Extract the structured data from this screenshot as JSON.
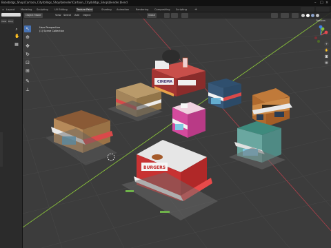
{
  "window": {
    "title": "Bobsbldgs_Shop\\Cartoon_City\\blldgs_Shop\\blender\\Cartoon_City\\blldgs_Shop\\blender.blend"
  },
  "workspace_tabs": [
    "Layout",
    "Modeling",
    "Sculpting",
    "UV Editing",
    "Texture Paint",
    "Shading",
    "Animation",
    "Rendering",
    "Compositing",
    "Scripting"
  ],
  "active_tab_index": 4,
  "viewport": {
    "mode": "Object Mode",
    "menus": [
      "View",
      "Select",
      "Add",
      "Object"
    ],
    "transform_orientation": "Global",
    "overlay_line1": "User Perspective",
    "overlay_line2": "(1) Scene Collection",
    "options_label": "Options"
  },
  "left_panel": {
    "mini_label_1": "View",
    "mini_label_2": "Disp"
  },
  "buildings": {
    "cinema_sign": "CINEMA",
    "burgers_sign": "BURGERS"
  },
  "icons": {
    "tools": [
      "cursor-icon",
      "cursor-crosshair-icon",
      "move-icon",
      "rotate-icon",
      "scale-icon",
      "transform-icon",
      "annotate-icon",
      "measure-icon"
    ],
    "nav": [
      "zoom-icon",
      "hand-icon",
      "camera-icon",
      "grid-icon"
    ]
  },
  "colors": {
    "active_tool": "#4772b3",
    "viewport_bg": "#3c3c3c",
    "axis_x": "#e4484f",
    "axis_y": "#89c23a",
    "axis_z": "#3f7fe4"
  }
}
